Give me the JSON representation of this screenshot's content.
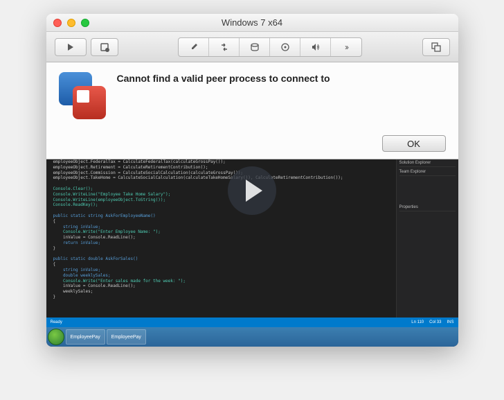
{
  "window": {
    "title": "Windows 7 x64"
  },
  "toolbar": {
    "play": "▶",
    "snapshot": "⎋",
    "settings": "⚙",
    "reset": "⟳",
    "disk": "⌀",
    "cdrom": "◉",
    "sound": "🔊",
    "more": "»",
    "fullscreen": "⧉"
  },
  "dialog": {
    "message": "Cannot find a valid peer process to connect to",
    "ok": "OK"
  },
  "vs": {
    "side_header1": "Solution Explorer",
    "side_header2": "Team Explorer",
    "side_props": "Properties",
    "status_ready": "Ready",
    "status_ln": "Ln 110",
    "status_col": "Col 33",
    "status_ins": "INS"
  },
  "code": {
    "line1": "employeeObject.FederalTax = CalculateFederalTax(calculateGrossPay());",
    "line2": "employeeObject.Retirement = CalculateRetirementContribution();",
    "line3": "employeeObject.Commission = CalculateSocialCalculation(calculateGrossPay());",
    "line4": "employeeObject.TakeHome = CalculateSocialCalculation(calculateTakeHomeSalary()), CalculateRetirementContribution());",
    "line5": "",
    "line6": "Console.Clear();",
    "line7": "Console.WriteLine(\"Employee Take Home Salary\");",
    "line8": "Console.WriteLine(employeeObject.ToString());",
    "line9": "Console.ReadKey();",
    "line10": "",
    "line11": "public static string AskForEmployeeName()",
    "line12": "{",
    "line13": "    string inValue;",
    "line14": "    Console.Write(\"Enter Employee Name: \");",
    "line15": "    inValue = Console.ReadLine();",
    "line16": "    return inValue;",
    "line17": "}",
    "line18": "",
    "line19": "public static double AskForSales()",
    "line20": "{",
    "line21": "    string inValue;",
    "line22": "    double weeklySales;",
    "line23": "    Console.Write(\"Enter sales made for the week: \");",
    "line24": "    inValue = Console.ReadLine();",
    "line25": "    weeklySales;",
    "line26": "}"
  },
  "taskbar": {
    "item1": "EmployeePay",
    "item2": "EmployeePay"
  }
}
